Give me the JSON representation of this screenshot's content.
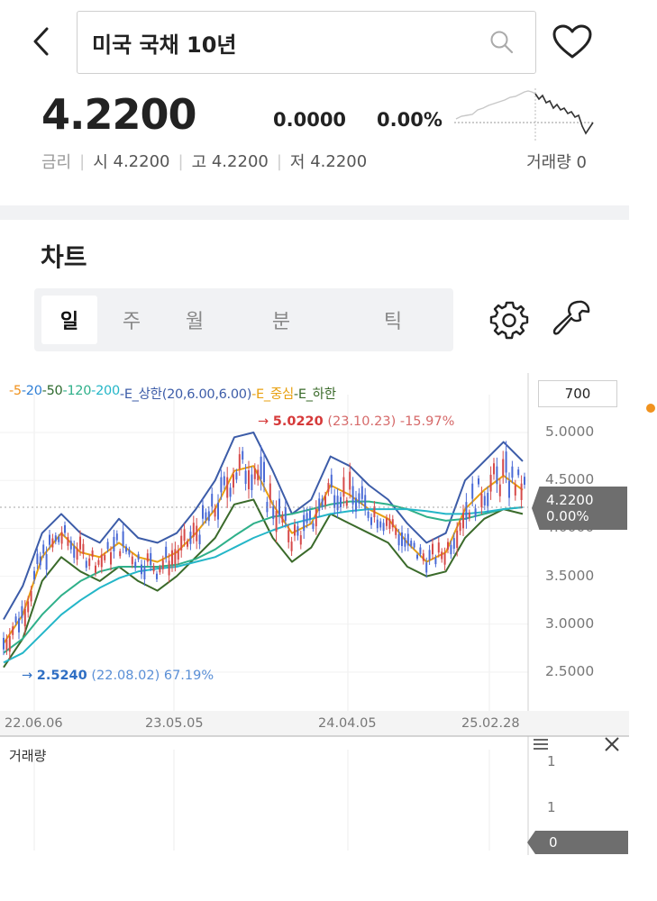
{
  "header": {
    "search_query": "미국 국채 10년"
  },
  "quote": {
    "price": "4.2200",
    "change": "0.0000",
    "change_pct": "0.00%",
    "meta_label": "금리",
    "open_label": "시",
    "open": "4.2200",
    "high_label": "고",
    "high": "4.2200",
    "low_label": "저",
    "low": "4.2200",
    "volume_label": "거래량",
    "volume": "0"
  },
  "chart_section": {
    "title": "차트",
    "tabs": [
      {
        "label": "일",
        "active": true
      },
      {
        "label": "주",
        "active": false
      },
      {
        "label": "월",
        "active": false
      },
      {
        "label": "분",
        "active": false
      },
      {
        "label": "틱",
        "active": false
      }
    ],
    "candle_count": "700",
    "legend": [
      {
        "text": "-5",
        "color": "#f0921e"
      },
      {
        "text": "-20",
        "color": "#2f7fd6"
      },
      {
        "text": "-50",
        "color": "#2e6a2e"
      },
      {
        "text": "-120",
        "color": "#2fb08a"
      },
      {
        "text": "-200",
        "color": "#24b6c8"
      },
      {
        "text": "-E_상한(20,6.00,6.00)",
        "color": "#3c5ca8"
      },
      {
        "text": "-E_중심",
        "color": "#e8a010"
      },
      {
        "text": "-E_하한",
        "color": "#3a6a2a"
      }
    ],
    "high_marker": {
      "arrow": "→",
      "value": "5.0220",
      "date": "(23.10.23)",
      "pct": "-15.97%"
    },
    "low_marker": {
      "arrow": "→",
      "value": "2.5240",
      "date": "(22.08.02)",
      "pct": "67.19%"
    },
    "current_tag": {
      "price": "4.2200",
      "pct": "0.00%"
    },
    "volume_panel": {
      "label": "거래량",
      "tick_top": "1",
      "tick_mid": "1",
      "tag": "0"
    }
  },
  "chart_data": {
    "type": "line",
    "x_ticks": [
      "22.06.06",
      "23.05.05",
      "24.04.05",
      "25.02.28"
    ],
    "y_ticks": [
      "5.0000",
      "4.5000",
      "4.0000",
      "3.5000",
      "3.0000",
      "2.5000"
    ],
    "ylim": [
      2.2,
      5.3
    ],
    "series": [
      {
        "name": "E_상한",
        "color": "#3c5ca8",
        "values": [
          3.05,
          3.4,
          3.95,
          4.15,
          3.95,
          3.85,
          4.1,
          3.9,
          3.85,
          3.95,
          4.2,
          4.5,
          4.95,
          5.0,
          4.6,
          4.15,
          4.3,
          4.75,
          4.65,
          4.45,
          4.3,
          4.05,
          3.85,
          3.95,
          4.5,
          4.7,
          4.9,
          4.7
        ]
      },
      {
        "name": "E_중심",
        "color": "#e8a010",
        "values": [
          2.8,
          3.1,
          3.7,
          3.95,
          3.75,
          3.7,
          3.85,
          3.7,
          3.65,
          3.75,
          3.95,
          4.2,
          4.6,
          4.65,
          4.25,
          3.95,
          4.05,
          4.45,
          4.35,
          4.2,
          4.1,
          3.85,
          3.65,
          3.75,
          4.2,
          4.4,
          4.55,
          4.4
        ]
      },
      {
        "name": "E_하한",
        "color": "#3a6a2a",
        "values": [
          2.55,
          2.85,
          3.45,
          3.7,
          3.55,
          3.45,
          3.6,
          3.45,
          3.35,
          3.5,
          3.7,
          3.9,
          4.25,
          4.3,
          3.9,
          3.65,
          3.8,
          4.15,
          4.05,
          3.95,
          3.85,
          3.6,
          3.5,
          3.55,
          3.9,
          4.1,
          4.2,
          4.15
        ]
      },
      {
        "name": "120",
        "color": "#2fb08a",
        "values": [
          2.7,
          2.85,
          3.1,
          3.3,
          3.45,
          3.55,
          3.6,
          3.6,
          3.6,
          3.62,
          3.68,
          3.78,
          3.92,
          4.05,
          4.12,
          4.15,
          4.2,
          4.25,
          4.28,
          4.28,
          4.25,
          4.2,
          4.12,
          4.08,
          4.1,
          4.15,
          4.2,
          4.22
        ]
      },
      {
        "name": "200",
        "color": "#24b6c8",
        "values": [
          2.6,
          2.7,
          2.9,
          3.1,
          3.25,
          3.38,
          3.48,
          3.55,
          3.58,
          3.6,
          3.65,
          3.7,
          3.8,
          3.9,
          3.98,
          4.05,
          4.1,
          4.15,
          4.18,
          4.2,
          4.2,
          4.2,
          4.18,
          4.15,
          4.15,
          4.17,
          4.2,
          4.22
        ]
      }
    ]
  }
}
